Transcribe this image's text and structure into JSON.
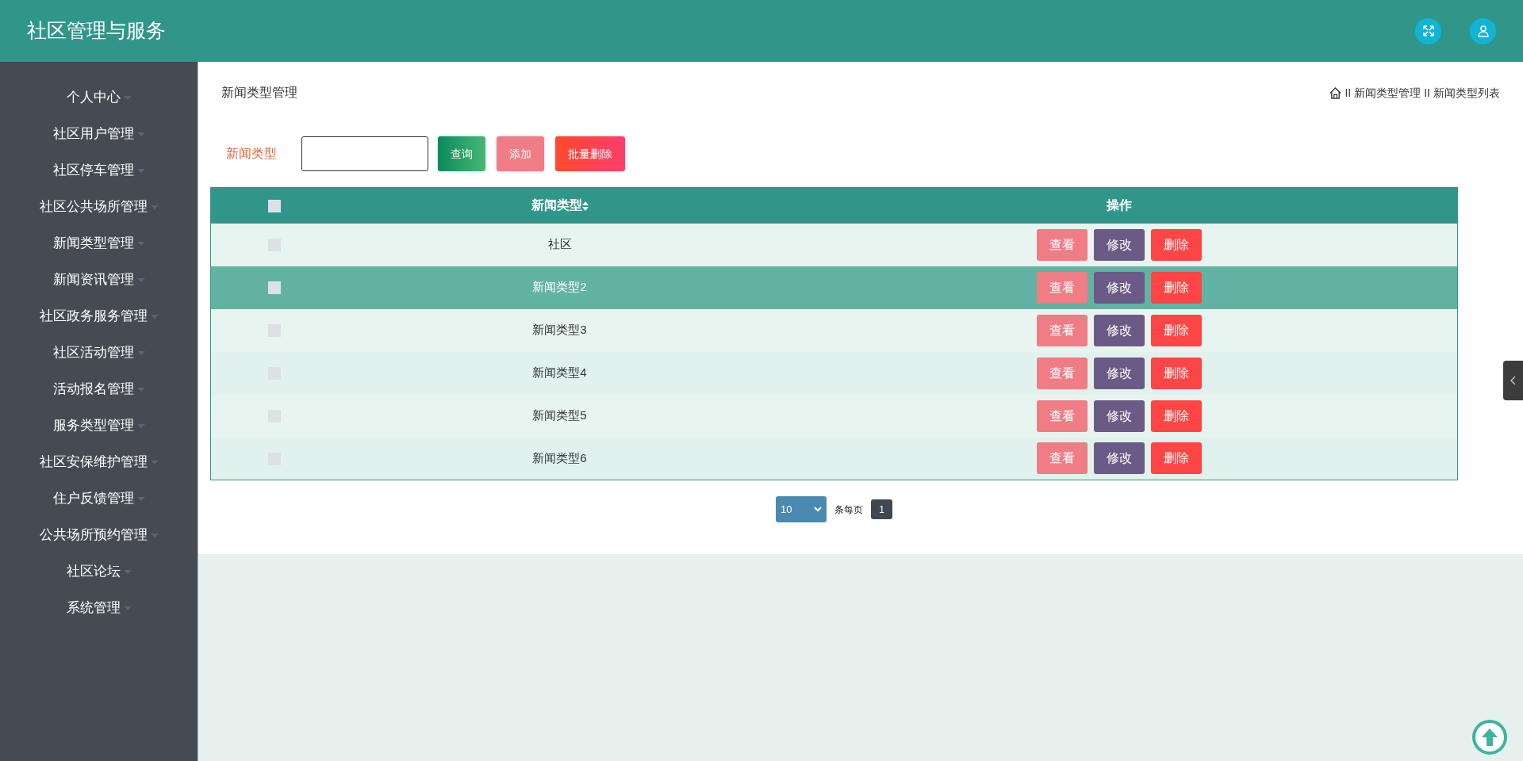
{
  "header": {
    "title": "社区管理与服务"
  },
  "sidebar": {
    "items": [
      {
        "label": "个人中心"
      },
      {
        "label": "社区用户管理"
      },
      {
        "label": "社区停车管理"
      },
      {
        "label": "社区公共场所管理"
      },
      {
        "label": "新闻类型管理"
      },
      {
        "label": "新闻资讯管理"
      },
      {
        "label": "社区政务服务管理"
      },
      {
        "label": "社区活动管理"
      },
      {
        "label": "活动报名管理"
      },
      {
        "label": "服务类型管理"
      },
      {
        "label": "社区安保维护管理"
      },
      {
        "label": "住户反馈管理"
      },
      {
        "label": "公共场所预约管理"
      },
      {
        "label": "社区论坛"
      },
      {
        "label": "系统管理"
      }
    ]
  },
  "page_title": "新闻类型管理",
  "breadcrumb": [
    {
      "separator": "II",
      "label": "新闻类型管理"
    },
    {
      "separator": "II",
      "label": "新闻类型列表"
    }
  ],
  "search": {
    "label": "新闻类型",
    "buttons": [
      "查询",
      "添加",
      "批量删除"
    ]
  },
  "table": {
    "header_checked": false,
    "columns": [
      "新闻类型",
      "操作"
    ],
    "rows": [
      {
        "checked": false,
        "selected": false,
        "type": "社区",
        "actions": [
          "查看",
          "修改",
          "删除"
        ]
      },
      {
        "checked": false,
        "selected": true,
        "type": "新闻类型2",
        "actions": [
          "查看",
          "修改",
          "删除"
        ]
      },
      {
        "checked": false,
        "selected": false,
        "type": "新闻类型3",
        "actions": [
          "查看",
          "修改",
          "删除"
        ]
      },
      {
        "checked": false,
        "selected": false,
        "type": "新闻类型4",
        "actions": [
          "查看",
          "修改",
          "删除"
        ]
      },
      {
        "checked": false,
        "selected": false,
        "type": "新闻类型5",
        "actions": [
          "查看",
          "修改",
          "删除"
        ]
      },
      {
        "checked": false,
        "selected": false,
        "type": "新闻类型6",
        "actions": [
          "查看",
          "修改",
          "删除"
        ]
      }
    ]
  },
  "pagination": {
    "page_size": "10",
    "per_page_label": "条每页",
    "pages": [
      {
        "label": "1",
        "selected": true
      }
    ]
  }
}
